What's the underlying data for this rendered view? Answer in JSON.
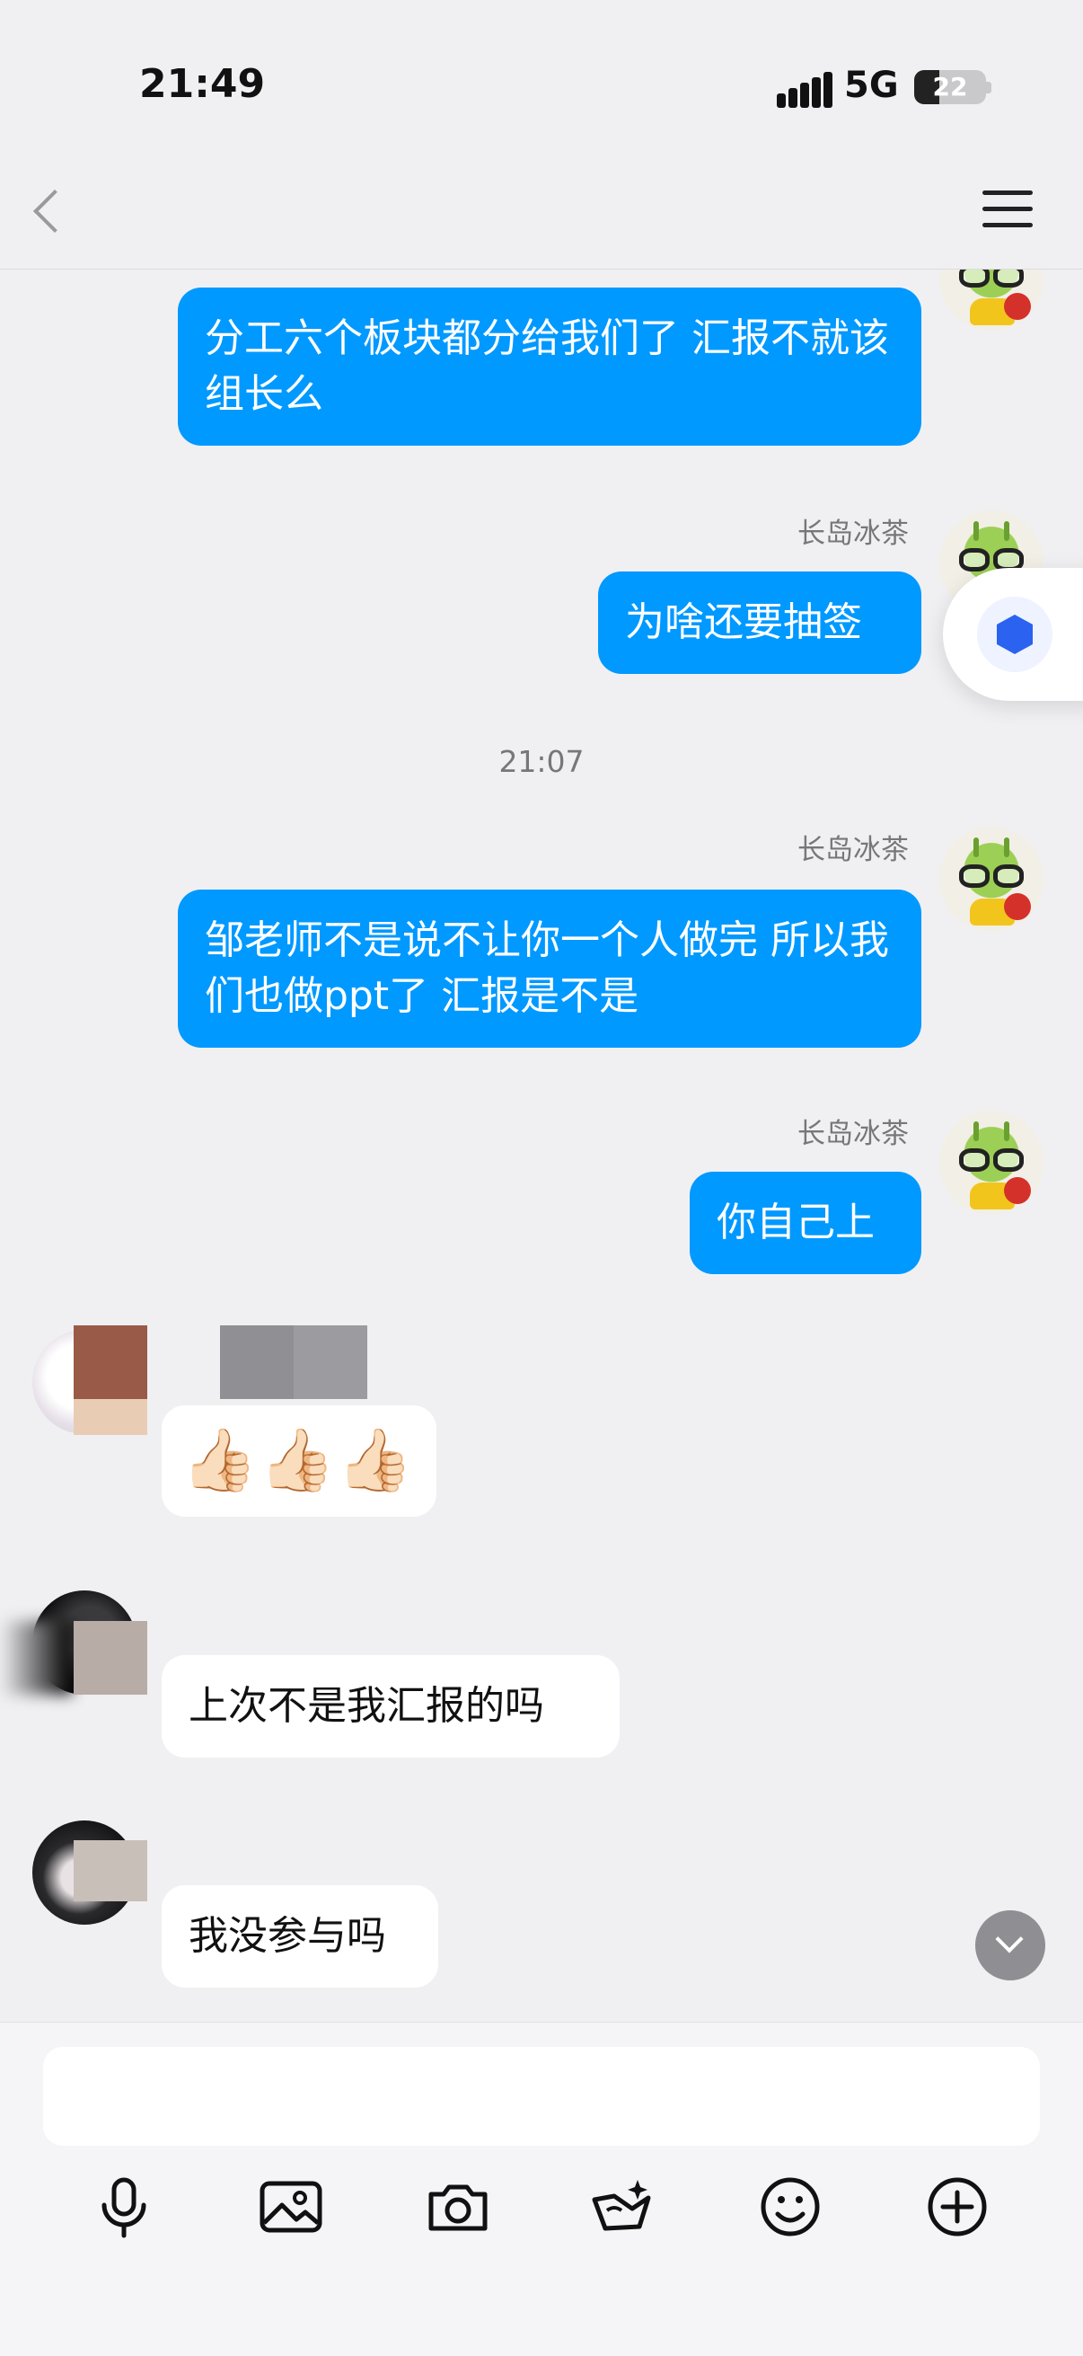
{
  "status_bar": {
    "time": "21:49",
    "network": "5G",
    "battery": "22"
  },
  "header": {
    "title": ""
  },
  "messages": [
    {
      "sender": "",
      "side": "me",
      "text": "分工六个板块都分给我们了 汇报不就该组长么"
    },
    {
      "sender": "长岛冰茶",
      "side": "me",
      "text": "为啥还要抽签"
    },
    {
      "sender": "长岛冰茶",
      "side": "me",
      "text": "邹老师不是说不让你一个人做完 所以我们也做ppt了 汇报是不是"
    },
    {
      "sender": "长岛冰茶",
      "side": "me",
      "text": "你自己上"
    },
    {
      "sender": "",
      "side": "them",
      "text": "👍🏻👍🏻👍🏻"
    },
    {
      "sender": "",
      "side": "them",
      "text": "上次不是我汇报的吗"
    },
    {
      "sender": "",
      "side": "them",
      "text": "我没参与吗"
    }
  ],
  "timestamp": "21:07",
  "input": {
    "placeholder": ""
  },
  "toolbar": [
    "microphone-icon",
    "image-icon",
    "camera-icon",
    "red-packet-icon",
    "emoji-icon",
    "plus-icon"
  ],
  "colors": {
    "my_bubble": "#0099ff",
    "their_bubble": "#ffffff",
    "background": "#f0f0f3"
  }
}
